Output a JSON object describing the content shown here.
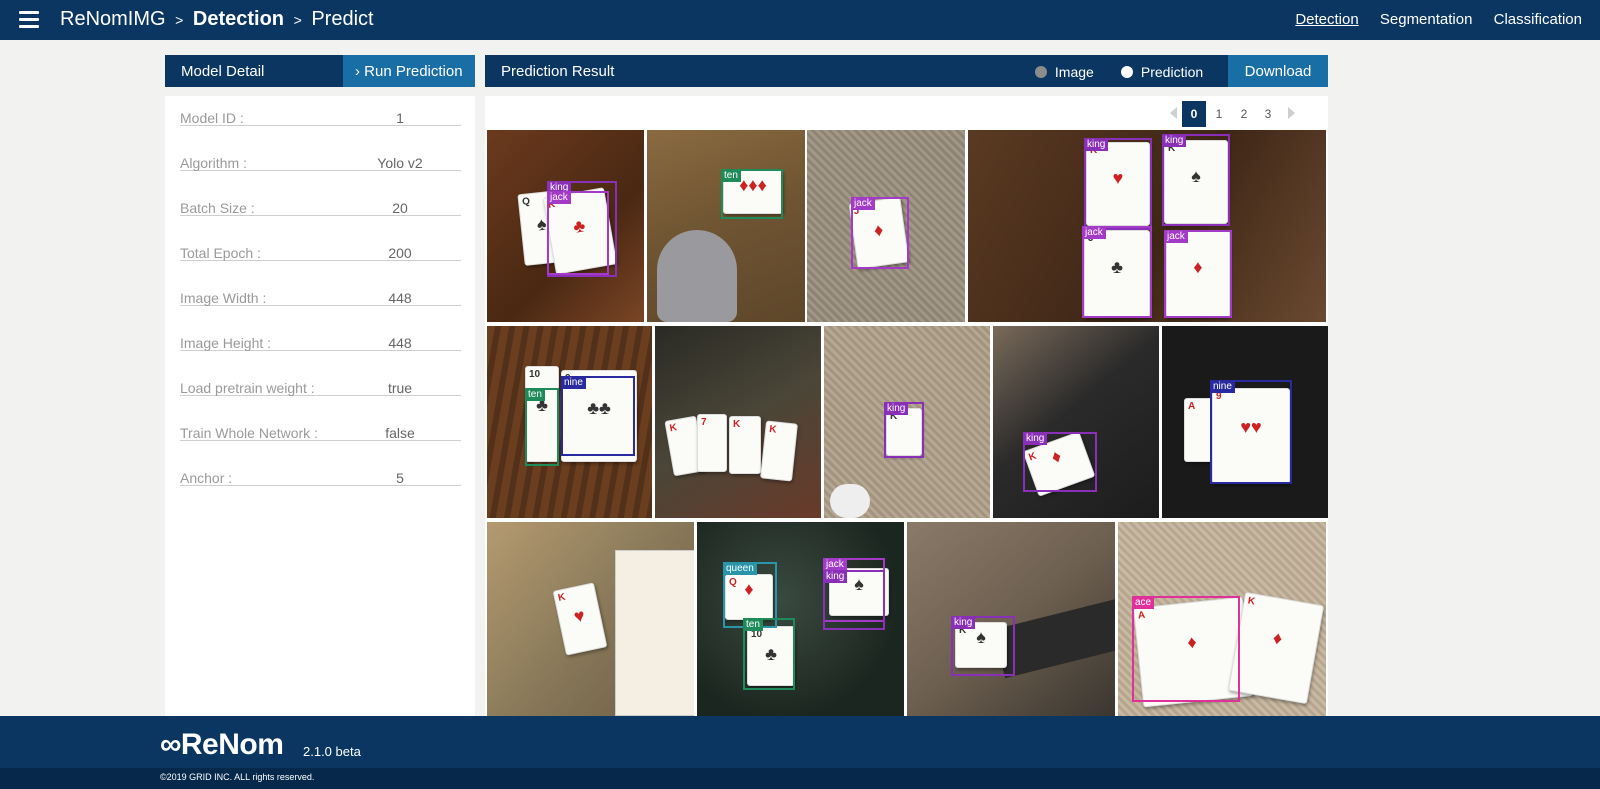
{
  "header": {
    "app_name": "ReNomIMG",
    "sep1": ">",
    "section": "Detection",
    "sep2": ">",
    "page": "Predict",
    "nav": [
      "Detection",
      "Segmentation",
      "Classification"
    ],
    "active_nav": "Detection"
  },
  "model_detail": {
    "title": "Model Detail",
    "run_label": "Run Prediction",
    "fields": [
      {
        "label": "Model ID :",
        "value": "1"
      },
      {
        "label": "Algorithm :",
        "value": "Yolo v2"
      },
      {
        "label": "Batch Size :",
        "value": "20"
      },
      {
        "label": "Total Epoch :",
        "value": "200"
      },
      {
        "label": "Image Width :",
        "value": "448"
      },
      {
        "label": "Image Height :",
        "value": "448"
      },
      {
        "label": "Load pretrain weight :",
        "value": "true"
      },
      {
        "label": "Train Whole Network :",
        "value": "false"
      },
      {
        "label": "Anchor :",
        "value": "5"
      }
    ]
  },
  "prediction": {
    "title": "Prediction Result",
    "radio_image": "Image",
    "radio_prediction": "Prediction",
    "selected_view": "Prediction",
    "download_label": "Download",
    "pages": [
      "0",
      "1",
      "2",
      "3"
    ],
    "current_page": "0",
    "label_colors": {
      "king": "#8a2fb8",
      "jack": "#a43ac8",
      "ten": "#1f8a5a",
      "nine": "#2a2aa0",
      "queen": "#2a95a8",
      "ace": "#e0309a"
    },
    "detections": [
      "king",
      "jack",
      "ten",
      "jack",
      "king",
      "king",
      "jack",
      "jack",
      "ten",
      "nine",
      "king",
      "king",
      "nine",
      "queen",
      "jack",
      "king",
      "ten",
      "king",
      "ace"
    ]
  },
  "footer": {
    "logo": "∞ReNom",
    "version": "2.1.0 beta",
    "copyright": "©2019 GRID INC. ALL rights reserved."
  }
}
